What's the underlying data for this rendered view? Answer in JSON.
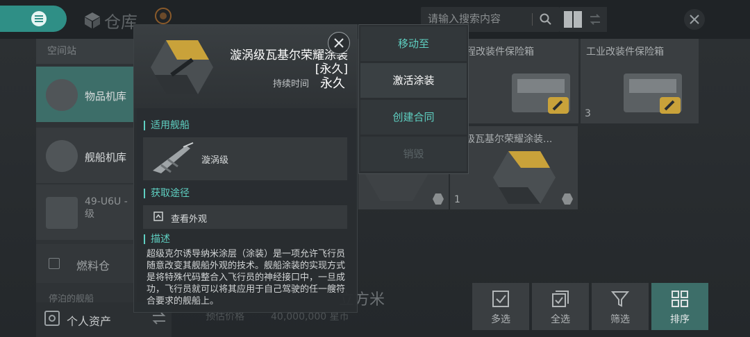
{
  "header": {
    "title": "仓库",
    "search_placeholder": "请输入搜索内容"
  },
  "sidebar": {
    "section_label": "空间站",
    "items": [
      {
        "label": "物品机库",
        "active": true
      },
      {
        "label": "舰船机库",
        "active": false
      },
      {
        "label": "49-U6U - 级",
        "active": false
      }
    ],
    "fuel_label": "燃料仓",
    "docked_label": "停泊的舰船",
    "personal_assets": "个人资产"
  },
  "grid": {
    "cards": [
      {
        "name": "程改装件保险箱",
        "qty": ""
      },
      {
        "name": "工业改装件保险箱",
        "qty": "3"
      },
      {
        "name": "涡级瓦基尔荣耀涂装...",
        "qty": "1"
      }
    ]
  },
  "footer": {
    "volume_text": "立方米",
    "est_label": "预估价格",
    "est_value": "40,000,000 星币",
    "buttons": [
      {
        "label": "多选",
        "icon": "multi-select-icon",
        "active": false
      },
      {
        "label": "全选",
        "icon": "select-all-icon",
        "active": false
      },
      {
        "label": "筛选",
        "icon": "filter-icon",
        "active": false
      },
      {
        "label": "排序",
        "icon": "sort-icon",
        "active": true
      }
    ]
  },
  "popup": {
    "item_name": "漩涡级瓦基尔荣耀涂装[永久]",
    "duration_label": "持续时间",
    "duration_value": "永久",
    "applicable_title": "适用舰船",
    "ship_name": "漩涡级",
    "source_title": "获取途径",
    "view_appearance": "查看外观",
    "desc_title": "描述",
    "description": "超级克尔诱导纳米涂层（涂装）是一项允许飞行员随意改变其舰船外观的技术。舰船涂装的实现方式是将特殊代码整合入飞行员的神经接口中，一旦成功，飞行员就可以将其应用于自己驾驶的任一艘符合要求的舰船上。"
  },
  "context_menu": [
    {
      "label": "移动至",
      "state": "teal"
    },
    {
      "label": "激活涂装",
      "state": "active"
    },
    {
      "label": "创建合同",
      "state": "teal"
    },
    {
      "label": "销毁",
      "state": "dim"
    }
  ],
  "colors": {
    "accent": "#5fd0c2",
    "active_bg": "#3d6e69",
    "hex_gold": "#c9a23a"
  }
}
